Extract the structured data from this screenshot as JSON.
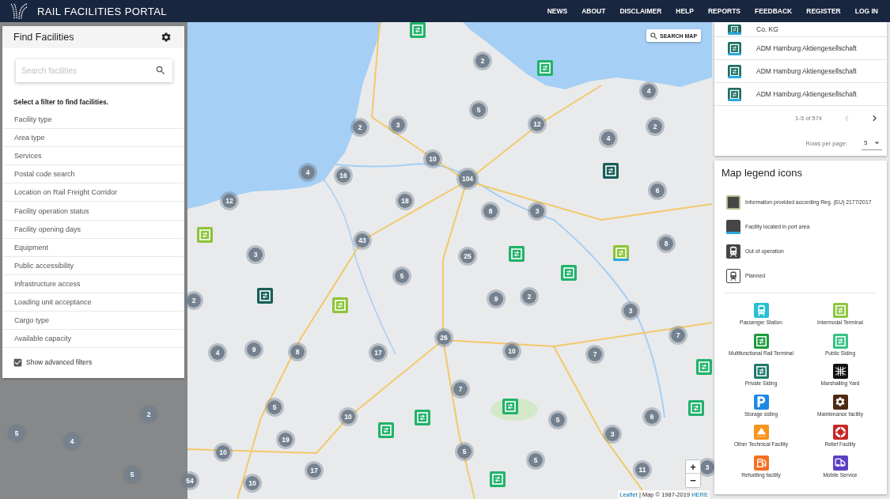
{
  "header": {
    "title": "RAIL FACILITIES PORTAL",
    "nav": [
      "NEWS",
      "ABOUT",
      "DISCLAIMER",
      "HELP",
      "REPORTS",
      "FEEDBACK",
      "REGISTER",
      "LOG IN"
    ]
  },
  "find_panel": {
    "title": "Find Facilities",
    "search": {
      "placeholder": "Search facilities"
    },
    "hint": "Select a filter to find facilities.",
    "filters": [
      "Facility type",
      "Area type",
      "Services",
      "Postal code search",
      "Location on Rail Freight Corridor",
      "Facility operation status",
      "Facility opening days",
      "Equipment",
      "Public accessibility",
      "Infrastructure access",
      "Loading unit acceptance",
      "Cargo type",
      "Available capacity"
    ],
    "advanced": {
      "label": "Show advanced filters",
      "checked": true
    }
  },
  "map": {
    "search_button": "SEARCH MAP",
    "clusters": [
      {
        "count": "2"
      },
      {
        "count": "4"
      },
      {
        "count": "5"
      },
      {
        "count": "2"
      },
      {
        "count": "3"
      },
      {
        "count": "12"
      },
      {
        "count": "2"
      },
      {
        "count": "4"
      },
      {
        "count": "10"
      },
      {
        "count": "4"
      },
      {
        "count": "16"
      },
      {
        "count": "104"
      },
      {
        "count": "6"
      },
      {
        "count": "12"
      },
      {
        "count": "18"
      },
      {
        "count": "8"
      },
      {
        "count": "3"
      },
      {
        "count": "43"
      },
      {
        "count": "8"
      },
      {
        "count": "3"
      },
      {
        "count": "25"
      },
      {
        "count": "5"
      },
      {
        "count": "2"
      },
      {
        "count": "9"
      },
      {
        "count": "2"
      },
      {
        "count": "3"
      },
      {
        "count": "26"
      },
      {
        "count": "7"
      },
      {
        "count": "4"
      },
      {
        "count": "9"
      },
      {
        "count": "8"
      },
      {
        "count": "17"
      },
      {
        "count": "10"
      },
      {
        "count": "7"
      },
      {
        "count": "7"
      },
      {
        "count": "2"
      },
      {
        "count": "5"
      },
      {
        "count": "10"
      },
      {
        "count": "5"
      },
      {
        "count": "6"
      },
      {
        "count": "5"
      },
      {
        "count": "4"
      },
      {
        "count": "19"
      },
      {
        "count": "3"
      },
      {
        "count": "10"
      },
      {
        "count": "5"
      },
      {
        "count": "5"
      },
      {
        "count": "5"
      },
      {
        "count": "17"
      },
      {
        "count": "11"
      },
      {
        "count": "3"
      },
      {
        "count": "54"
      },
      {
        "count": "10"
      }
    ],
    "facilities": [
      {
        "kind": "public_siding",
        "port": false
      },
      {
        "kind": "public_siding",
        "port": false
      },
      {
        "kind": "private_siding",
        "port": false
      },
      {
        "kind": "intermodal",
        "port": false
      },
      {
        "kind": "public_siding",
        "port": false
      },
      {
        "kind": "intermodal",
        "port": true
      },
      {
        "kind": "public_siding",
        "port": false
      },
      {
        "kind": "private_siding",
        "port": false
      },
      {
        "kind": "intermodal",
        "port": false
      },
      {
        "kind": "public_siding",
        "port": false
      },
      {
        "kind": "public_siding",
        "port": false
      },
      {
        "kind": "public_siding",
        "port": false
      },
      {
        "kind": "public_siding",
        "port": false
      },
      {
        "kind": "public_siding",
        "port": false
      },
      {
        "kind": "public_siding",
        "port": false
      }
    ],
    "zoom": [
      "+",
      "−"
    ],
    "attribution": [
      {
        "text": "Leaflet",
        "link": true
      },
      {
        "text": "| Map © 1987-2019",
        "link": false
      },
      {
        "text": "HERE",
        "link": true
      }
    ]
  },
  "results": {
    "rows": [
      {
        "name": "Co. KG",
        "port": true
      },
      {
        "name": "ADM Hamburg Aktiengesellschaft",
        "port": true
      },
      {
        "name": "ADM Hamburg Aktiengesellschaft",
        "port": true
      },
      {
        "name": "ADM Hamburg Aktiengesellschaft",
        "port": true
      }
    ],
    "pager": {
      "range": "1-5 of 574",
      "prev": {
        "disabled": true
      },
      "next": {
        "disabled": false
      }
    },
    "rows_per_page": {
      "label": "Rows per page:",
      "value": "5"
    }
  },
  "legend": {
    "title": "Map legend icons",
    "statuses": [
      {
        "kind": "eu_info",
        "label": "Information provided according Reg. (EU) 2177/2017"
      },
      {
        "kind": "port_area",
        "label": "Facility located in port area"
      },
      {
        "kind": "out_of_operation",
        "label": "Out of operation"
      },
      {
        "kind": "planned",
        "label": "Planned"
      }
    ],
    "types": [
      {
        "kind": "passenger",
        "label": "Passenger Station",
        "color": "#27bfd2"
      },
      {
        "kind": "intermodal",
        "label": "Intermodal Terminal",
        "color": "#8cc63f"
      },
      {
        "kind": "multifunctional",
        "label": "Multifunctional Rail Terminal",
        "color": "#1e9b3c"
      },
      {
        "kind": "public_siding",
        "label": "Public Siding",
        "color": "#39c286"
      },
      {
        "kind": "private_siding",
        "label": "Private Siding",
        "color": "#1f7a6c"
      },
      {
        "kind": "marshalling",
        "label": "Marshalling Yard",
        "color": "#111111"
      },
      {
        "kind": "storage",
        "label": "Storage siding",
        "color": "#1e88e5"
      },
      {
        "kind": "maintenance",
        "label": "Maintenance facility",
        "color": "#4e2a12"
      },
      {
        "kind": "other_technical",
        "label": "Other Technical Facility",
        "color": "#f7941d"
      },
      {
        "kind": "relief",
        "label": "Relief Facility",
        "color": "#c62828"
      },
      {
        "kind": "refuelling",
        "label": "Refuelling facility",
        "color": "#f37021"
      },
      {
        "kind": "mobile",
        "label": "Mobile Service",
        "color": "#5b3fc4"
      }
    ]
  }
}
